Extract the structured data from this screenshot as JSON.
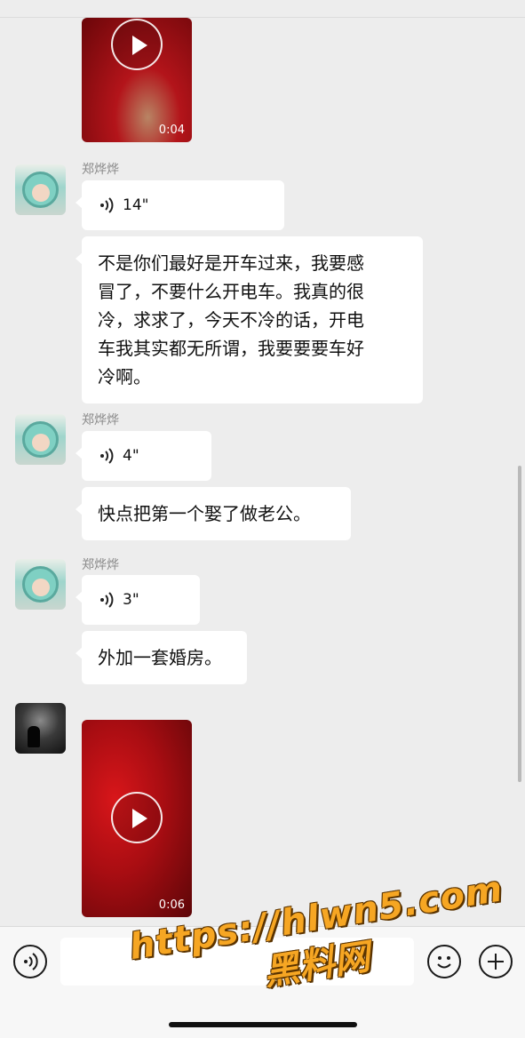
{
  "messages": [
    {
      "type": "video",
      "duration": "0:04"
    },
    {
      "sender": "郑烨烨",
      "voice": "14\"",
      "text": "不是你们最好是开车过来，我要感冒了，不要什么开电车。我真的很冷，求求了，今天不冷的话，开电车我其实都无所谓，我要要要车好冷啊。"
    },
    {
      "sender": "郑烨烨",
      "voice": "4\"",
      "text": "快点把第一个娶了做老公。"
    },
    {
      "sender": "郑烨烨",
      "voice": "3\"",
      "text": "外加一套婚房。"
    },
    {
      "type": "video",
      "duration": "0:06"
    }
  ],
  "text_lines": {
    "m1": [
      "不是你们最好是开车过来，我要感",
      "冒了，不要什么开电车。我真的很",
      "冷，求求了，今天不冷的话，开电",
      "车我其实都无所谓，我要要要车好",
      "冷啊。"
    ]
  },
  "input_bar": {
    "voice_icon": "voice-mode-icon",
    "emoji_icon": "emoji-icon",
    "add_icon": "plus-icon"
  },
  "watermark": {
    "url": "https://hlwn5.com",
    "brand": "黑料网"
  },
  "colors": {
    "chat_background": "#ededed",
    "bubble": "#ffffff",
    "watermark": "#f6a623"
  }
}
